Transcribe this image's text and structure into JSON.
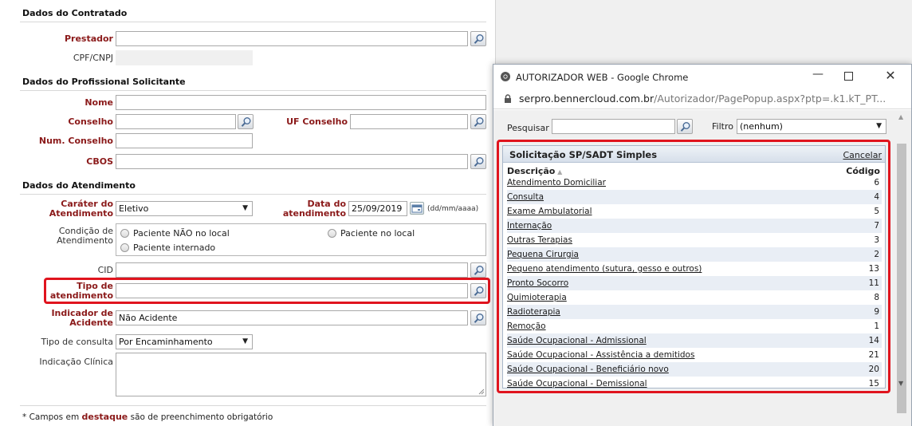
{
  "form": {
    "contratado": {
      "title": "Dados do Contratado",
      "prestador_label": "Prestador",
      "cpf_label": "CPF/CNPJ"
    },
    "profissional": {
      "title": "Dados do Profissional Solicitante",
      "nome_label": "Nome",
      "conselho_label": "Conselho",
      "uf_conselho_label": "UF Conselho",
      "num_conselho_label": "Num. Conselho",
      "cbos_label": "CBOS"
    },
    "atendimento": {
      "title": "Dados do Atendimento",
      "carater_label_1": "Caráter do",
      "carater_label_2": "Atendimento",
      "carater_value": "Eletivo",
      "data_label_1": "Data do",
      "data_label_2": "atendimento",
      "data_value": "25/09/2019",
      "data_format": "(dd/mm/aaaa)",
      "condicao_label_1": "Condição de",
      "condicao_label_2": "Atendimento",
      "radio_nao_local": "Paciente NÃO no local",
      "radio_no_local": "Paciente no local",
      "radio_internado": "Paciente internado",
      "cid_label": "CID",
      "tipo_label_1": "Tipo de",
      "tipo_label_2": "atendimento",
      "indicador_label_1": "Indicador de",
      "indicador_label_2": "Acidente",
      "indicador_value": "Não Acidente",
      "tipo_consulta_label": "Tipo de consulta",
      "tipo_consulta_value": "Por Encaminhamento",
      "indicacao_label": "Indicação Clínica"
    },
    "footer": {
      "prefix": "* Campos em",
      "highlight": "destaque",
      "suffix": "são de preenchimento obrigatório"
    }
  },
  "popup": {
    "window_title": "AUTORIZADOR WEB - Google Chrome",
    "url_host": "serpro.bennercloud.com.br",
    "url_path": "/Autorizador/PagePopup.aspx?ptp=.k1.kT_PT...",
    "search_label": "Pesquisar",
    "search_value": "",
    "filter_label": "Filtro",
    "filter_value": "(nenhum)",
    "grid_title": "Solicitação SP/SADT Simples",
    "cancel_label": "Cancelar",
    "col_desc": "Descrição",
    "col_code": "Código",
    "rows": [
      {
        "desc": "Atendimento Domiciliar",
        "code": "6"
      },
      {
        "desc": "Consulta",
        "code": "4"
      },
      {
        "desc": "Exame Ambulatorial",
        "code": "5"
      },
      {
        "desc": "Internação",
        "code": "7"
      },
      {
        "desc": "Outras Terapias",
        "code": "3"
      },
      {
        "desc": "Pequena Cirurgia",
        "code": "2"
      },
      {
        "desc": "Pequeno atendimento (sutura, gesso e outros)",
        "code": "13"
      },
      {
        "desc": "Pronto Socorro",
        "code": "11"
      },
      {
        "desc": "Quimioterapia",
        "code": "8"
      },
      {
        "desc": "Radioterapia",
        "code": "9"
      },
      {
        "desc": "Remoção",
        "code": "1"
      },
      {
        "desc": "Saúde Ocupacional - Admissional",
        "code": "14"
      },
      {
        "desc": "Saúde Ocupacional - Assistência a demitidos",
        "code": "21"
      },
      {
        "desc": "Saúde Ocupacional - Beneficiário novo",
        "code": "20"
      },
      {
        "desc": "Saúde Ocupacional - Demissional",
        "code": "15"
      }
    ]
  },
  "colors": {
    "required_label": "#8b1a1a",
    "highlight_frame": "#e0141e",
    "grid_header": "#dde5ef"
  }
}
